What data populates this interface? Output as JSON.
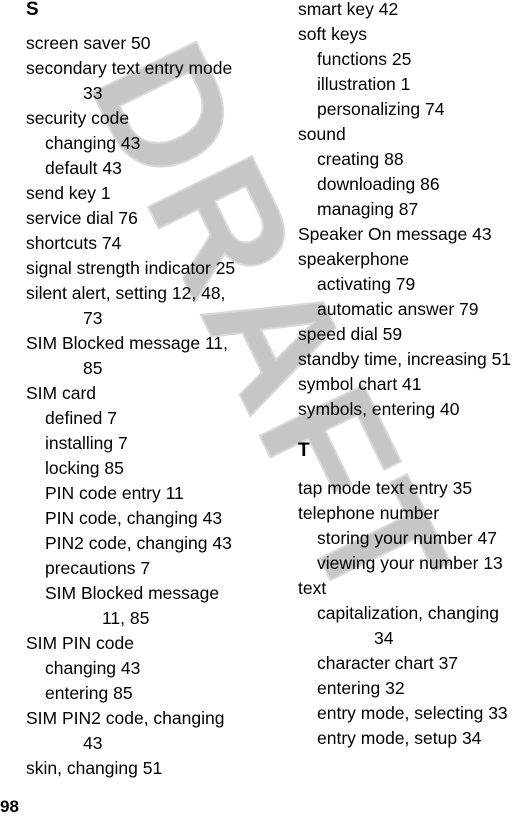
{
  "page": {
    "number": "98",
    "watermark": "DRAFT"
  },
  "left_column": {
    "heading": "S",
    "lines": [
      {
        "text": "screen saver  50",
        "level": 0
      },
      {
        "text": "secondary text entry mode",
        "level": 0
      },
      {
        "text": "33",
        "level": "cont0"
      },
      {
        "text": "security code",
        "level": 0
      },
      {
        "text": "changing  43",
        "level": 1
      },
      {
        "text": "default  43",
        "level": 1
      },
      {
        "text": "send key  1",
        "level": 0
      },
      {
        "text": "service dial  76",
        "level": 0
      },
      {
        "text": "shortcuts  74",
        "level": 0
      },
      {
        "text": "signal strength indicator  25",
        "level": 0
      },
      {
        "text": "silent alert, setting  12, 48,",
        "level": 0
      },
      {
        "text": "73",
        "level": "cont0"
      },
      {
        "text": "SIM Blocked message  11,",
        "level": 0
      },
      {
        "text": "85",
        "level": "cont0"
      },
      {
        "text": "SIM card",
        "level": 0
      },
      {
        "text": "defined  7",
        "level": 1
      },
      {
        "text": "installing  7",
        "level": 1
      },
      {
        "text": "locking  85",
        "level": 1
      },
      {
        "text": "PIN code entry  11",
        "level": 1
      },
      {
        "text": "PIN code, changing  43",
        "level": 1
      },
      {
        "text": "PIN2 code, changing  43",
        "level": 1
      },
      {
        "text": "precautions  7",
        "level": 1
      },
      {
        "text": "SIM Blocked message",
        "level": 1
      },
      {
        "text": "11, 85",
        "level": "cont1"
      },
      {
        "text": "SIM PIN code",
        "level": 0
      },
      {
        "text": "changing  43",
        "level": 1
      },
      {
        "text": "entering  85",
        "level": 1
      },
      {
        "text": "SIM PIN2 code, changing",
        "level": 0
      },
      {
        "text": "43",
        "level": "cont0"
      },
      {
        "text": "skin, changing  51",
        "level": 0
      }
    ]
  },
  "right_column": {
    "lines_before_t": [
      {
        "text": "smart key  42",
        "level": 0
      },
      {
        "text": "soft keys",
        "level": 0
      },
      {
        "text": "functions  25",
        "level": 1
      },
      {
        "text": "illustration  1",
        "level": 1
      },
      {
        "text": "personalizing  74",
        "level": 1
      },
      {
        "text": "sound",
        "level": 0
      },
      {
        "text": "creating  88",
        "level": 1
      },
      {
        "text": "downloading  86",
        "level": 1
      },
      {
        "text": "managing  87",
        "level": 1
      },
      {
        "text": "Speaker On message  43",
        "level": 0
      },
      {
        "text": "speakerphone",
        "level": 0
      },
      {
        "text": "activating  79",
        "level": 1
      },
      {
        "text": "automatic answer  79",
        "level": 1
      },
      {
        "text": "speed dial  59",
        "level": 0
      },
      {
        "text": "standby time, increasing  51",
        "level": 0
      },
      {
        "text": "symbol chart  41",
        "level": 0
      },
      {
        "text": "symbols, entering  40",
        "level": 0
      }
    ],
    "heading": "T",
    "lines_after_t": [
      {
        "text": "tap mode text entry  35",
        "level": 0
      },
      {
        "text": "telephone number",
        "level": 0
      },
      {
        "text": "storing your number  47",
        "level": 1
      },
      {
        "text": "viewing your number  13",
        "level": 1
      },
      {
        "text": "text",
        "level": 0
      },
      {
        "text": "capitalization, changing",
        "level": 1
      },
      {
        "text": "34",
        "level": "cont1"
      },
      {
        "text": "character chart  37",
        "level": 1
      },
      {
        "text": "entering  32",
        "level": 1
      },
      {
        "text": "entry mode, selecting  33",
        "level": 1
      },
      {
        "text": "entry mode, setup  34",
        "level": 1
      }
    ]
  }
}
